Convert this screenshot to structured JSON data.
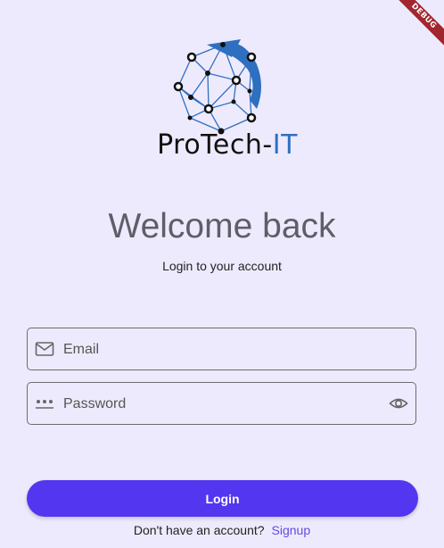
{
  "debug_banner": "DEBUG",
  "logo": {
    "brand_main": "ProTech-",
    "brand_accent": "IT",
    "colors": {
      "node": "#111111",
      "edge": "#2E6FBF",
      "arrow": "#2E6FBF"
    }
  },
  "welcome": {
    "title": "Welcome back",
    "subtitle": "Login to your account"
  },
  "form": {
    "email": {
      "placeholder": "Email",
      "icon": "mail-icon"
    },
    "password": {
      "placeholder": "Password",
      "icon": "password-dots-icon",
      "toggle_icon": "eye-icon"
    }
  },
  "login_button": {
    "label": "Login",
    "color": "#5336F0"
  },
  "footer": {
    "prompt": "Don't have an account?",
    "signup_label": "Signup"
  },
  "colors": {
    "background": "#EEEAFD",
    "accent": "#5336F0",
    "link": "#5F4BE0"
  }
}
